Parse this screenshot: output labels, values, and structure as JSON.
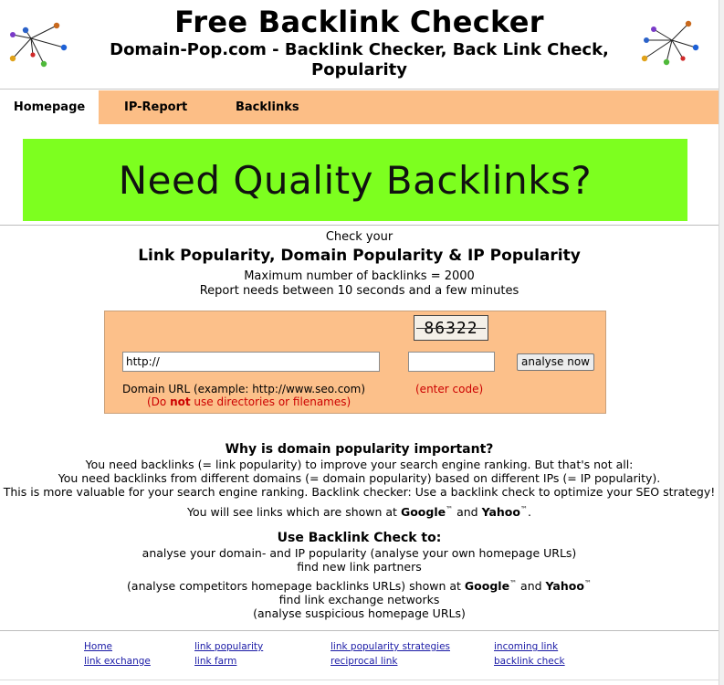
{
  "header": {
    "title": "Free Backlink Checker",
    "subtitle": "Domain-Pop.com - Backlink Checker, Back Link Check, Popularity"
  },
  "nav": {
    "tabs": [
      {
        "label": "Homepage",
        "active": true
      },
      {
        "label": "IP-Report",
        "active": false
      },
      {
        "label": "Backlinks",
        "active": false
      }
    ],
    "bar_color": "#fcbe86"
  },
  "banner": {
    "text": "Need Quality Backlinks?",
    "background": "#7dff1f"
  },
  "intro": {
    "check_label": "Check your",
    "heading": "Link Popularity, Domain Popularity & IP Popularity",
    "max_backlinks": "Maximum number of backlinks = 2000",
    "report_time": "Report needs between 10 seconds and a few minutes"
  },
  "form": {
    "captcha_digits": [
      "8",
      "6",
      "3",
      "2",
      "2"
    ],
    "url_value": "http://",
    "code_value": "",
    "submit_label": "analyse now",
    "url_hint": "Domain URL (example: http://www.seo.com)",
    "url_warning_pre": "(Do ",
    "url_warning_strong": "not",
    "url_warning_post": " use directories or filenames)",
    "code_hint": "(enter code)"
  },
  "why": {
    "heading": "Why is domain popularity important?",
    "line1": "You need backlinks (= link popularity) to improve your search engine ranking. But that's not all:",
    "line2": "You need backlinks from different domains (= domain popularity) based on different IPs (= IP popularity).",
    "line3": "This is more valuable for your search engine ranking. Backlink checker: Use a backlink check to optimize your SEO strategy!",
    "line4_pre": "You will see links which are shown at ",
    "google": "Google",
    "tm": "™",
    "and": " and ",
    "yahoo": "Yahoo",
    "line4_post": "."
  },
  "use": {
    "heading": "Use Backlink Check to:",
    "line1": "analyse your domain- and IP popularity (analyse your own homepage URLs)",
    "line2": "find new link partners",
    "line3_pre": "(analyse competitors homepage backlinks URLs) shown at ",
    "google": "Google",
    "tm": "™",
    "and": " and ",
    "yahoo": "Yahoo",
    "line4": "find link exchange networks",
    "line5": "(analyse suspicious homepage URLs)"
  },
  "footer": {
    "links": [
      {
        "label": "Home"
      },
      {
        "label": "link popularity"
      },
      {
        "label": "link popularity strategies"
      },
      {
        "label": "incoming link"
      },
      {
        "label": "link exchange"
      },
      {
        "label": "link farm"
      },
      {
        "label": "reciprocal link"
      },
      {
        "label": "backlink check"
      }
    ]
  }
}
